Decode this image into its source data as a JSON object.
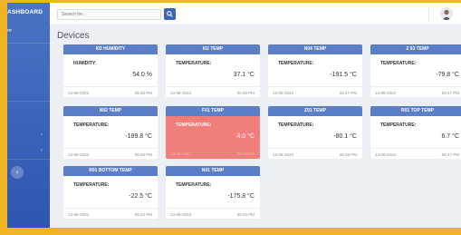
{
  "app": {
    "brand": "ASHBOARD"
  },
  "sidebar": {
    "selected_label": "re",
    "collapse_icon": "chevron-left-icon"
  },
  "topbar": {
    "search_placeholder": "Search for...",
    "search_icon": "search-icon",
    "avatar_icon": "user-avatar"
  },
  "page": {
    "title": "Devices"
  },
  "colors": {
    "header": "#5b7ec9",
    "alert": "#f07f7c",
    "accent": "#3d65bd",
    "sidebar": "#2f56b0"
  },
  "devices": [
    {
      "name": "I02 HUMIDITY",
      "label": "HUMIDITY:",
      "value": "54.0 %",
      "date": "13-08-2023",
      "time": "06:48 PM",
      "alert": false
    },
    {
      "name": "I02 TEMP",
      "label": "TEMPERATURE:",
      "value": "37.1 °C",
      "date": "13-08-2023",
      "time": "06:48 PM",
      "alert": false
    },
    {
      "name": "N04 TEMP",
      "label": "TEMPERATURE:",
      "value": "-191.5 °C",
      "date": "13-08-2023",
      "time": "06:47 PM",
      "alert": false
    },
    {
      "name": "Z 03   TEMP",
      "label": "TEMPERATURE:",
      "value": "-79.8 °C",
      "date": "13-08-2023",
      "time": "06:47 PM",
      "alert": false
    },
    {
      "name": "N02   TEMP",
      "label": "TEMPERATURE:",
      "value": "-189.8 °C",
      "date": "13-08-2023",
      "time": "06:48 PM",
      "alert": false
    },
    {
      "name": "F01   TEMP",
      "label": "TEMPERATURE:",
      "value": "4.0 °C",
      "date": "13-08-2023",
      "time": "06:48 PM",
      "alert": true
    },
    {
      "name": "Z01   TEMP",
      "label": "TEMPERATURE:",
      "value": "-80.1 °C",
      "date": "13-08-2023",
      "time": "06:48 PM",
      "alert": false
    },
    {
      "name": "R01 TOP   TEMP",
      "label": "TEMPERATURE:",
      "value": "6.7 °C",
      "date": "13-08-2023",
      "time": "06:47 PM",
      "alert": false
    },
    {
      "name": "R01 BOTTOM   TEMP",
      "label": "TEMPERATURE:",
      "value": "-22.5 °C",
      "date": "13-08-2023",
      "time": "06:48 PM",
      "alert": false
    },
    {
      "name": "N01   TEMP",
      "label": "TEMPERATURE:",
      "value": "-175.8 °C",
      "date": "13-08-2023",
      "time": "06:48 PM",
      "alert": false
    }
  ]
}
